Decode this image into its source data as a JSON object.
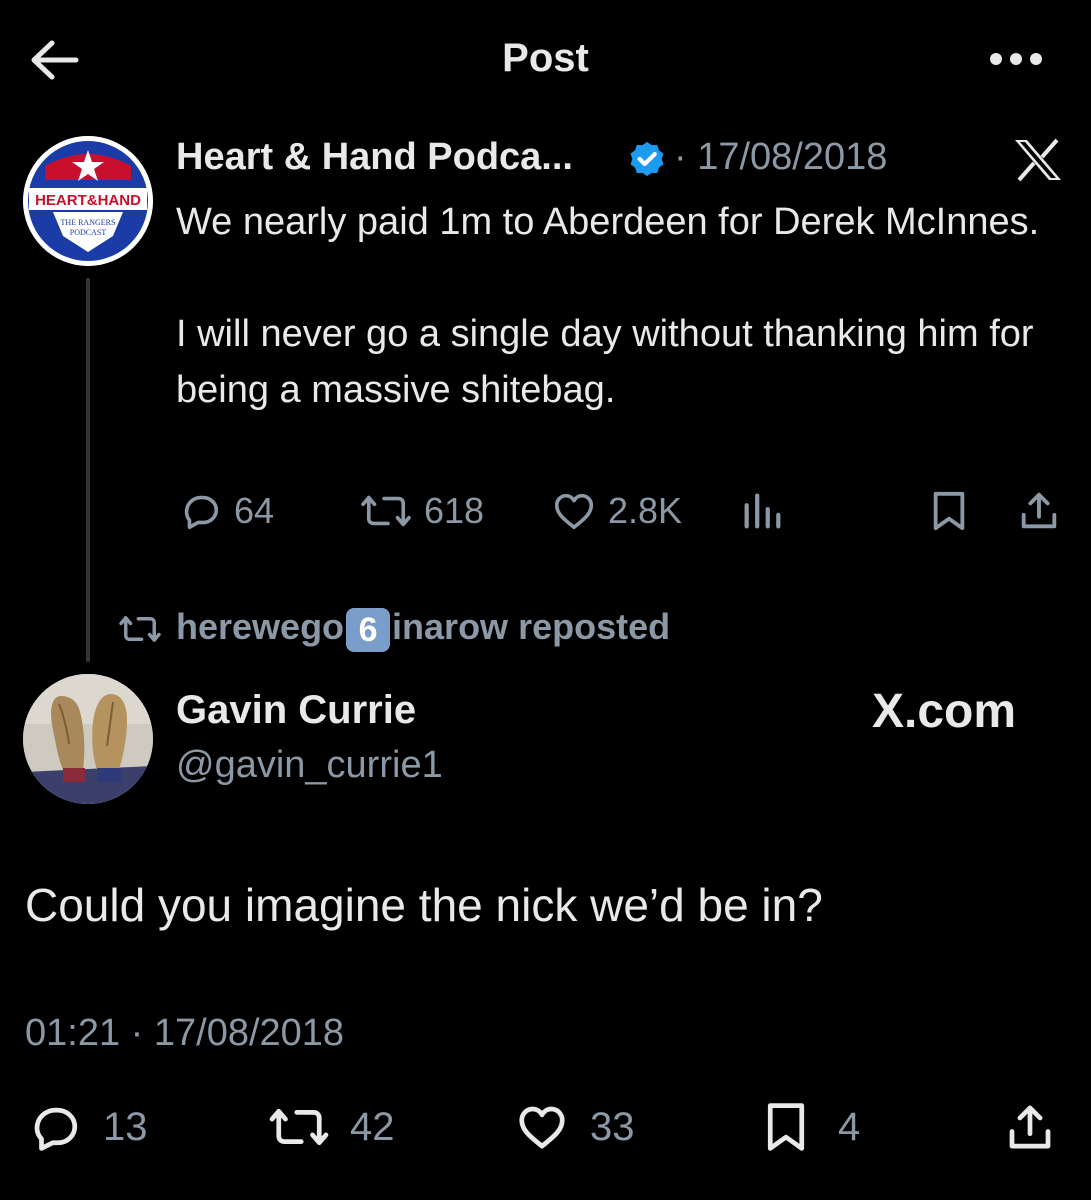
{
  "header": {
    "title": "Post"
  },
  "quoted_post": {
    "author_name": "Heart & Hand Podca...",
    "date": "· 17/08/2018",
    "text": "We nearly paid 1m to Aberdeen for Derek McInnes.\n\nI will never go a single day without thanking him for being a massive shitebag.",
    "avatar_text": {
      "line1": "HEART&HAND",
      "line2": "THE RANGERS",
      "line3": "PODCAST"
    },
    "stats": {
      "replies": "64",
      "reposts": "618",
      "likes": "2.8K"
    }
  },
  "repost_banner": {
    "user_prefix": "herewego",
    "emoji": "6",
    "user_suffix": "inarow reposted"
  },
  "main_post": {
    "author_name": "Gavin Currie",
    "handle": "@gavin_currie1",
    "watermark": "X.com",
    "text": "Could you imagine the nick we’d be in?",
    "timestamp": "01:21 · 17/08/2018",
    "stats": {
      "replies": "13",
      "reposts": "42",
      "likes": "33",
      "bookmarks": "4"
    }
  },
  "colors": {
    "background": "#000000",
    "primary_text": "#e7e9ea",
    "secondary_text": "#8b98a5",
    "verified_blue": "#1d9bf0",
    "thread_line": "#333639"
  }
}
